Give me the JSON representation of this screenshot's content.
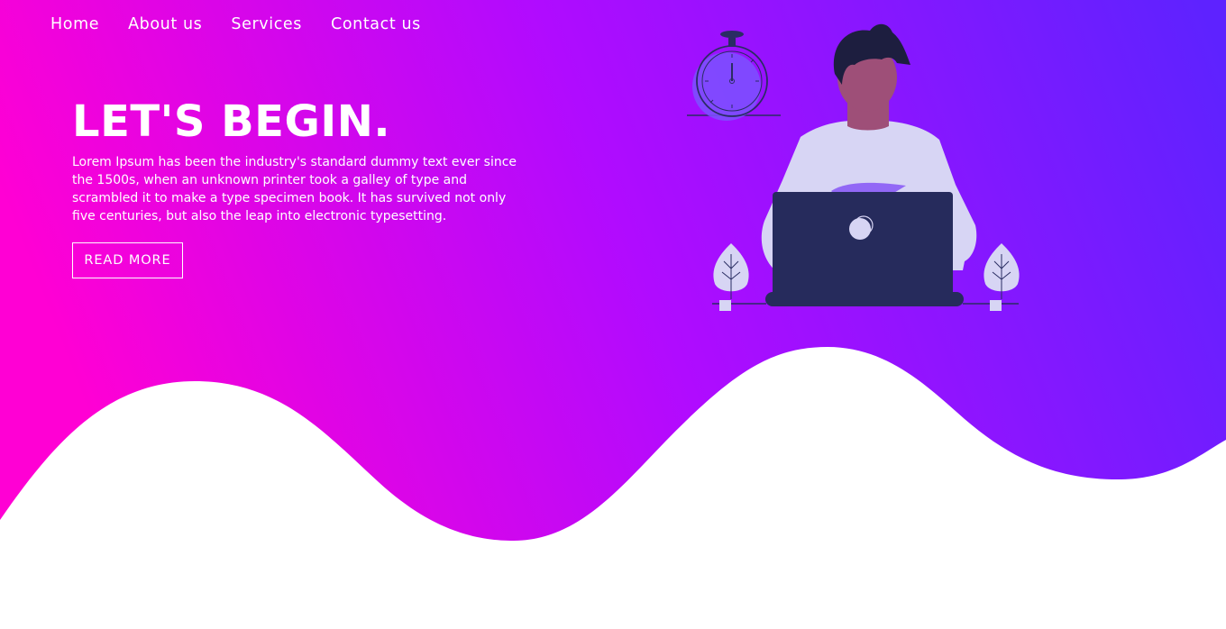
{
  "nav": {
    "items": [
      {
        "label": "Home"
      },
      {
        "label": "About us"
      },
      {
        "label": "Services"
      },
      {
        "label": "Contact us"
      }
    ]
  },
  "hero": {
    "title": "LET'S BEGIN.",
    "description": "Lorem Ipsum has been the industry's standard dummy text ever since the 1500s, when an unknown printer took a galley of type and scrambled it to make a type specimen book. It has survived not only five centuries, but also the leap into electronic typesetting.",
    "button_label": "READ MORE"
  },
  "illustration": {
    "subject": "person-working-on-laptop-illustration",
    "elements": [
      "stopwatch-icon",
      "person-figure",
      "laptop-icon",
      "plant-icon-left",
      "plant-icon-right"
    ]
  },
  "colors": {
    "gradient_start": "#ff00d4",
    "gradient_mid": "#a80bff",
    "gradient_end": "#5b24ff",
    "wave_fill": "#ffffff",
    "text": "#ffffff",
    "laptop": "#262b5c",
    "shirt": "#d7d5f4",
    "skin": "#9e4f78",
    "hair": "#1d1e3f",
    "accent": "#7b52ff"
  }
}
